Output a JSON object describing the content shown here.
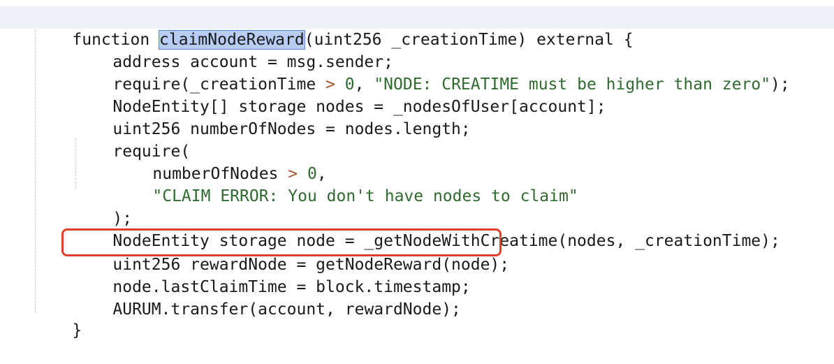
{
  "code": {
    "line1": {
      "pre": "function ",
      "selected": "claimNodeReward",
      "post": "(uint256 _creationTime) external {"
    },
    "line2": {
      "text": "address account = msg.sender;"
    },
    "line3": {
      "a": "require(_creationTime ",
      "op": ">",
      "b": " ",
      "num": "0",
      "c": ", ",
      "str": "\"NODE: CREATIME must be higher than zero\"",
      "d": ");"
    },
    "line4": {
      "text": "NodeEntity[] storage nodes = _nodesOfUser[account];"
    },
    "line5": {
      "text": "uint256 numberOfNodes = nodes.length;"
    },
    "line6": {
      "text": "require("
    },
    "line7": {
      "a": "numberOfNodes ",
      "op": ">",
      "b": " ",
      "num": "0",
      "c": ","
    },
    "line8": {
      "str": "\"CLAIM ERROR: You don't have nodes to claim\""
    },
    "line9": {
      "text": ");"
    },
    "line10": {
      "text": "NodeEntity storage node = _getNodeWithCreatime(nodes, _creationTime);"
    },
    "line11": {
      "text": "uint256 rewardNode = getNodeReward(node);"
    },
    "line12": {
      "text": "node.lastClaimTime = block.timestamp;"
    },
    "line13": {
      "text": "AURUM.transfer(account, rewardNode);"
    },
    "line14": {
      "text": "}"
    }
  },
  "annotation": {
    "color": "#e0402a"
  }
}
